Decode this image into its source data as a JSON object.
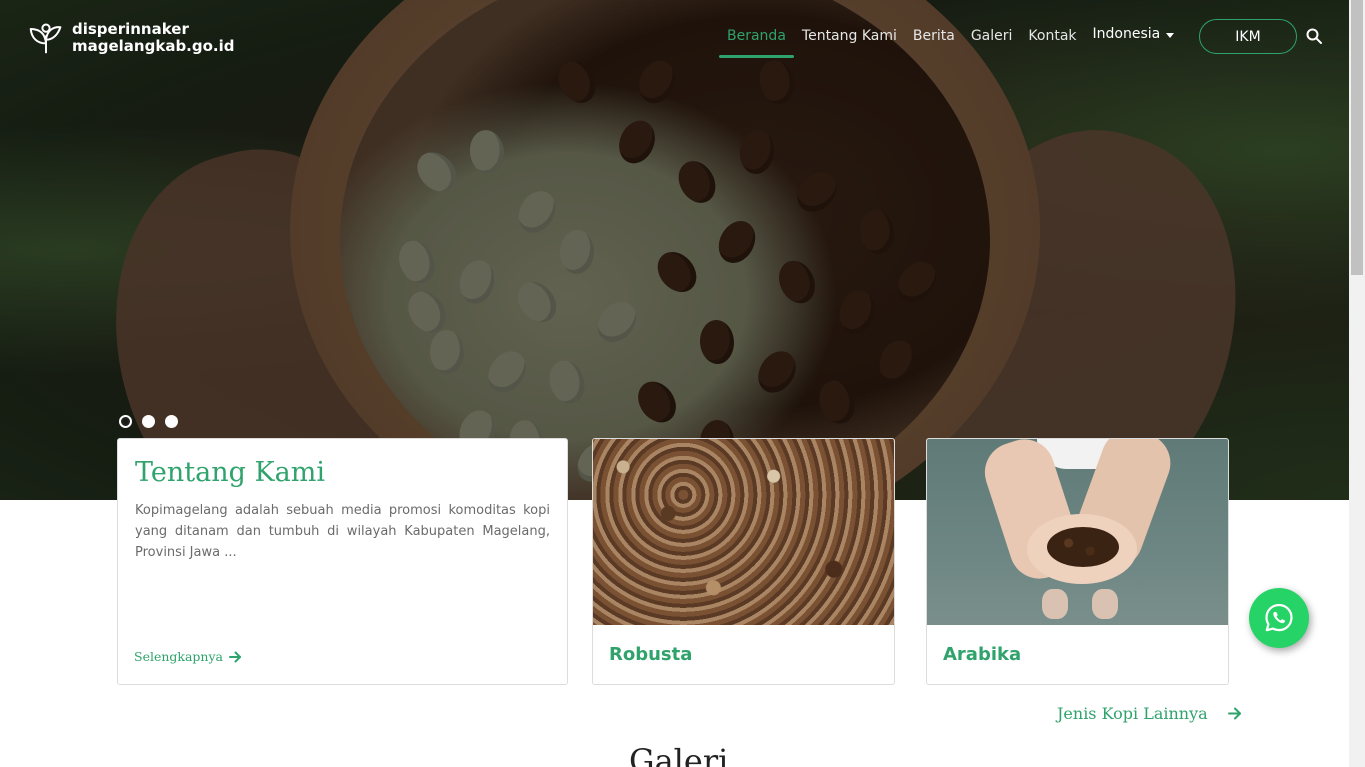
{
  "brand": {
    "line1": "disperinnaker",
    "line2": "magelangkab.go.id",
    "icon": "leaf-logo-icon"
  },
  "nav": {
    "items": [
      {
        "label": "Beranda",
        "active": true
      },
      {
        "label": "Tentang Kami",
        "active": false
      },
      {
        "label": "Berita",
        "active": false
      },
      {
        "label": "Galeri",
        "active": false
      },
      {
        "label": "Kontak",
        "active": false
      }
    ],
    "language": "Indonesia",
    "ikm_button": "IKM",
    "search_icon": "search-icon"
  },
  "carousel": {
    "slides": 3,
    "active_index": 0
  },
  "about": {
    "title": "Tentang Kami",
    "text": "Kopimagelang adalah sebuah media promosi komoditas kopi yang ditanam dan tumbuh di wilayah Kabupaten Magelang, Provinsi Jawa ...",
    "more": "Selengkapnya"
  },
  "coffee_types": [
    {
      "name": "Robusta"
    },
    {
      "name": "Arabika"
    }
  ],
  "more_types": "Jenis Kopi Lainnya",
  "gallery_title": "Galeri",
  "colors": {
    "accent": "#2fa36b",
    "whatsapp": "#25d366"
  },
  "whatsapp_icon": "whatsapp-icon"
}
